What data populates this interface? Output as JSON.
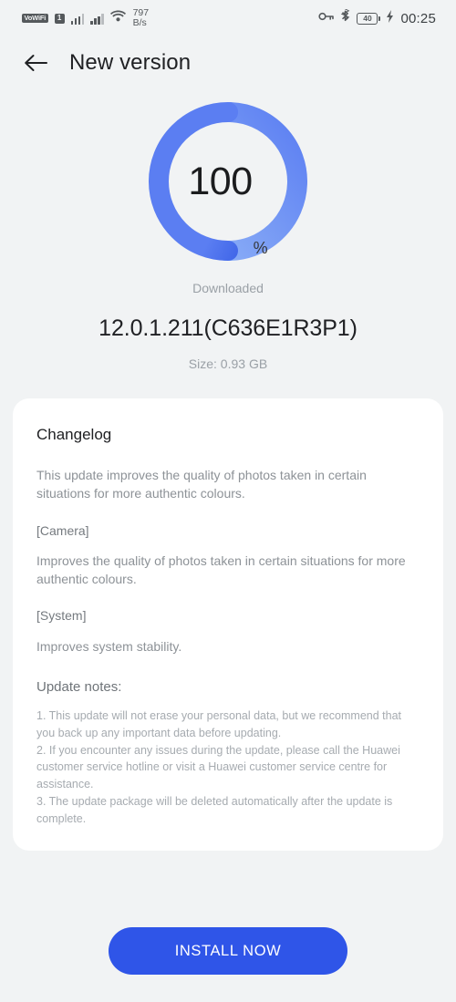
{
  "status_bar": {
    "volte_label": "VoWiFi",
    "sim_label": "1",
    "network_speed_value": "797",
    "network_speed_unit": "B/s",
    "key_icon": "key-icon",
    "bluetooth_icon": "bluetooth-icon",
    "battery_level": "40",
    "charging_icon": "charging-bolt-icon",
    "time": "00:25"
  },
  "app_bar": {
    "back_icon": "back-arrow-icon",
    "title": "New version"
  },
  "progress": {
    "percent_value": "100",
    "percent_sign": "%",
    "percent_number": 100,
    "status_text": "Downloaded",
    "ring_color_start": "#2a52e0",
    "ring_color_mid": "#5b7ef2",
    "ring_color_end": "#93b6f7",
    "track_color": "#e8eaec"
  },
  "update": {
    "version": "12.0.1.211(C636E1R3P1)",
    "size": "Size: 0.93 GB"
  },
  "changelog": {
    "title": "Changelog",
    "summary": "This update improves the quality of photos taken in certain situations for more authentic colours.",
    "sections": [
      {
        "heading": "[Camera]",
        "body": "Improves the quality of photos taken in certain situations for more authentic colours."
      },
      {
        "heading": "[System]",
        "body": "Improves system stability."
      }
    ],
    "notes_title": "Update notes:",
    "notes": [
      "1. This update will not erase your personal data, but we recommend that you back up any important data before updating.",
      "2. If you encounter any issues during the update, please call the Huawei customer service hotline or visit a Huawei customer service centre for assistance.",
      "3. The update package will be deleted automatically after the update is complete."
    ]
  },
  "footer": {
    "install_label": "INSTALL NOW",
    "install_color": "#2f55e8"
  }
}
